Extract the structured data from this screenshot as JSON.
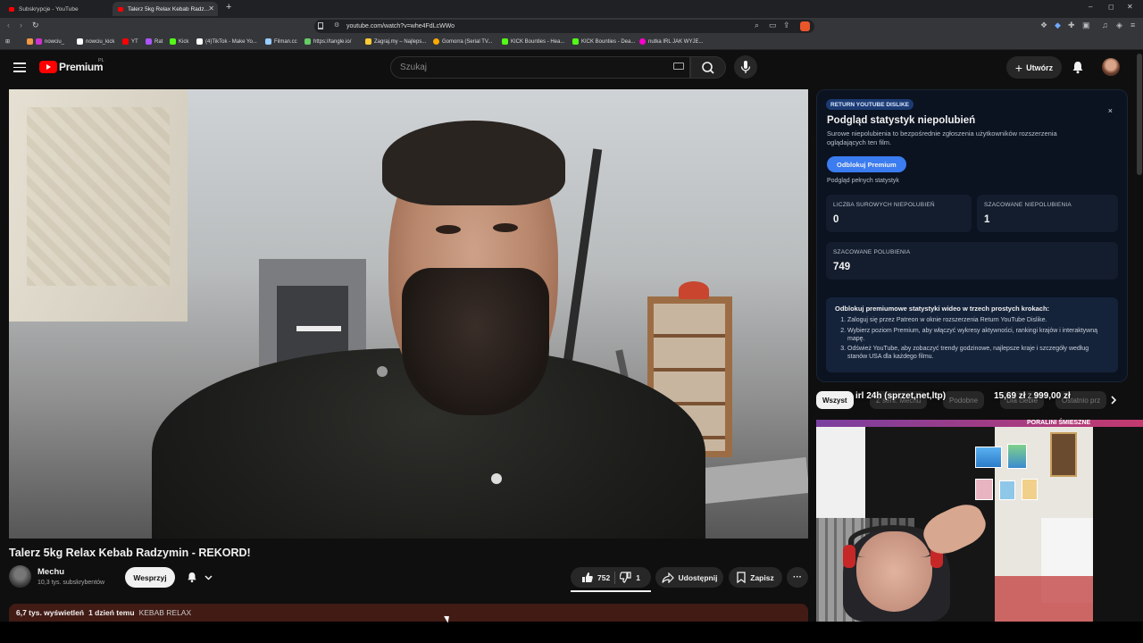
{
  "browser": {
    "tabs": [
      {
        "label": "Subskrypcje - YouTube",
        "active": false
      },
      {
        "label": "Talerz 5kg Relax Kebab Radz...",
        "active": true
      }
    ],
    "url": "youtube.com/watch?v=whe4FdLcWWo",
    "bookmarks": [
      "nowciu_",
      "nowciu_kick",
      "YT",
      "Rat",
      "Kick",
      "(4)TikTok - Make Yo...",
      "Filman.cc",
      "https://tangle.io/",
      "Zagraj.my – Najleps...",
      "Gomorra (Serial TV...",
      "KICK Bounties - Hea...",
      "KICK Bounties - Dea...",
      "nutka IRL JAK WYJE..."
    ]
  },
  "header": {
    "logo_text": "Premium",
    "logo_sup": "PL",
    "search_placeholder": "Szukaj",
    "create_label": "Utwórz"
  },
  "video": {
    "title": "Talerz 5kg Relax Kebab Radzymin - REKORD!",
    "channel_name": "Mechu",
    "channel_subs": "10,3 tys. subskrybentów",
    "support_label": "Wesprzyj",
    "likes": "752",
    "dislikes": "1",
    "share_label": "Udostępnij",
    "save_label": "Zapisz",
    "more_label": "···",
    "views": "6,7 tys. wyświetleń",
    "age": "1 dzień temu",
    "tag": "KEBAB RELAX"
  },
  "ryd": {
    "badge": "RETURN YOUTUBE DISLIKE",
    "close": "×",
    "title": "Podgląd statystyk niepolubień",
    "description": "Surowe niepolubienia to bezpośrednie zgłoszenia użytkowników rozszerzenia oglądających ten film.",
    "unlock_label": "Odblokuj Premium",
    "full_preview": "Podgląd pełnych statystyk",
    "stats": [
      {
        "label": "LICZBA SUROWYCH NIEPOLUBIEŃ",
        "value": "0"
      },
      {
        "label": "SZACOWANE NIEPOLUBIENIA",
        "value": "1"
      },
      {
        "label": "SZACOWANE POLUBIENIA",
        "value": "749"
      }
    ],
    "steps_title": "Odblokuj premiumowe statystyki wideo w trzech prostych krokach:",
    "steps": [
      "Zaloguj się przez Patreon w oknie rozszerzenia Return YouTube Dislike.",
      "Wybierz poziom Premium, aby włączyć wykresy aktywności, rankingi krajów i interaktywną mapę.",
      "Odśwież YouTube, aby zobaczyć trendy godzinowe, najlepsze kraje i szczegóły według stanów USA dla każdego filmu."
    ]
  },
  "chips": [
    "Wszyst",
    "Z serii: Mechu",
    "Podobne",
    "Dla ciebie",
    "Ostatnio prz"
  ],
  "overlay": {
    "title": "irl 24h (sprzet,net,ltp)",
    "price_current": "15,69 zł",
    "price_sep": "z",
    "price_goal": "999,00 zł",
    "webcam_label": "PORALINI ŚMIESZNE"
  }
}
